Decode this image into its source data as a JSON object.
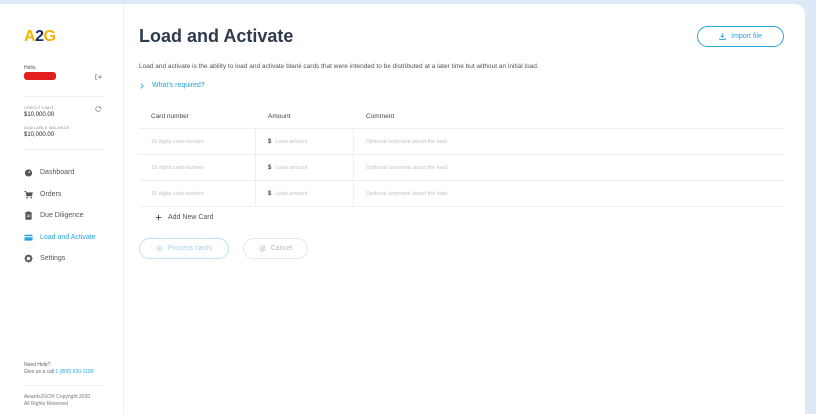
{
  "sidebar": {
    "logo_a": "A",
    "logo_2": "2",
    "logo_g": "G",
    "hello": "Hello,",
    "credit_limit_label": "CREDIT LIMIT",
    "credit_limit_value": "$10,000.00",
    "available_balance_label": "AVAILABLE BALANCE",
    "available_balance_value": "$10,000.00",
    "nav": [
      {
        "label": "Dashboard",
        "icon": "gauge-icon"
      },
      {
        "label": "Orders",
        "icon": "cart-icon"
      },
      {
        "label": "Due Diligence",
        "icon": "clipboard-icon"
      },
      {
        "label": "Load and Activate",
        "icon": "card-icon",
        "active": true
      },
      {
        "label": "Settings",
        "icon": "gear-icon"
      }
    ],
    "help_line1": "Need Help?",
    "help_line2_prefix": "Give us a call ",
    "help_phone": "1 (800) 630-1100",
    "copyright_line1": "Awards2GO® Copyright 2020",
    "copyright_line2": "All Rights Reserved"
  },
  "main": {
    "title": "Load and Activate",
    "import_label": "Import file",
    "description": "Load and activate is the ability to load and activate blank cards that were intended to be distributed at a later time but without an initial load.",
    "whats_required": "What's required?",
    "table": {
      "headers": [
        "Card number",
        "Amount",
        "Comment"
      ],
      "currency": "$",
      "rows": [
        {
          "card_placeholder": "16 digits card number",
          "amount_placeholder": "Load amount",
          "comment_placeholder": "Optional comment about the load"
        },
        {
          "card_placeholder": "16 digits card number",
          "amount_placeholder": "Load amount",
          "comment_placeholder": "Optional comment about the load"
        },
        {
          "card_placeholder": "16 digits card number",
          "amount_placeholder": "Load amount",
          "comment_placeholder": "Optional comment about the load"
        }
      ]
    },
    "add_card_label": "Add New Card",
    "process_label": "Process cards",
    "cancel_label": "Cancel"
  },
  "colors": {
    "accent": "#2aa3dc",
    "logo_yellow": "#f5b400",
    "logo_navy": "#1a2a6c",
    "title": "#2f3b4c",
    "background": "#dde9f7"
  }
}
